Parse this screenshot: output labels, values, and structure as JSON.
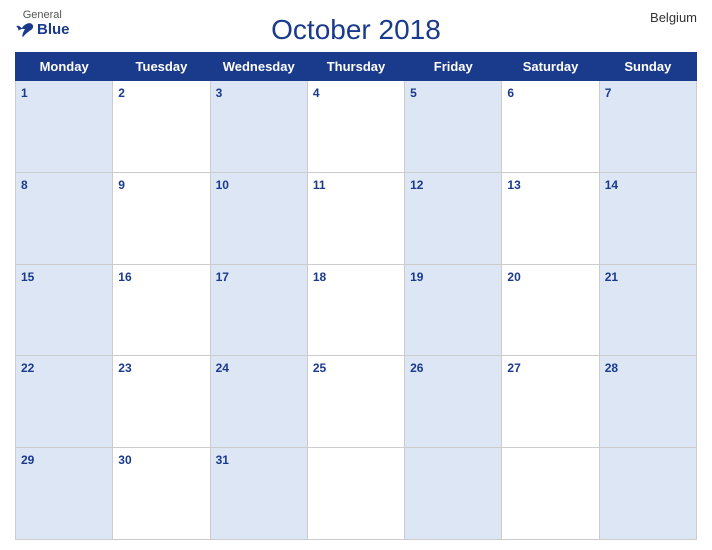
{
  "header": {
    "logo_general": "General",
    "logo_blue": "Blue",
    "title": "October 2018",
    "country": "Belgium"
  },
  "days_of_week": [
    "Monday",
    "Tuesday",
    "Wednesday",
    "Thursday",
    "Friday",
    "Saturday",
    "Sunday"
  ],
  "weeks": [
    [
      {
        "day": 1,
        "colored": true
      },
      {
        "day": 2,
        "colored": false
      },
      {
        "day": 3,
        "colored": true
      },
      {
        "day": 4,
        "colored": false
      },
      {
        "day": 5,
        "colored": true
      },
      {
        "day": 6,
        "colored": false
      },
      {
        "day": 7,
        "colored": true
      }
    ],
    [
      {
        "day": 8,
        "colored": true
      },
      {
        "day": 9,
        "colored": false
      },
      {
        "day": 10,
        "colored": true
      },
      {
        "day": 11,
        "colored": false
      },
      {
        "day": 12,
        "colored": true
      },
      {
        "day": 13,
        "colored": false
      },
      {
        "day": 14,
        "colored": true
      }
    ],
    [
      {
        "day": 15,
        "colored": true
      },
      {
        "day": 16,
        "colored": false
      },
      {
        "day": 17,
        "colored": true
      },
      {
        "day": 18,
        "colored": false
      },
      {
        "day": 19,
        "colored": true
      },
      {
        "day": 20,
        "colored": false
      },
      {
        "day": 21,
        "colored": true
      }
    ],
    [
      {
        "day": 22,
        "colored": true
      },
      {
        "day": 23,
        "colored": false
      },
      {
        "day": 24,
        "colored": true
      },
      {
        "day": 25,
        "colored": false
      },
      {
        "day": 26,
        "colored": true
      },
      {
        "day": 27,
        "colored": false
      },
      {
        "day": 28,
        "colored": true
      }
    ],
    [
      {
        "day": 29,
        "colored": true
      },
      {
        "day": 30,
        "colored": false
      },
      {
        "day": 31,
        "colored": true
      },
      {
        "day": null,
        "colored": false
      },
      {
        "day": null,
        "colored": true
      },
      {
        "day": null,
        "colored": false
      },
      {
        "day": null,
        "colored": true
      }
    ]
  ]
}
